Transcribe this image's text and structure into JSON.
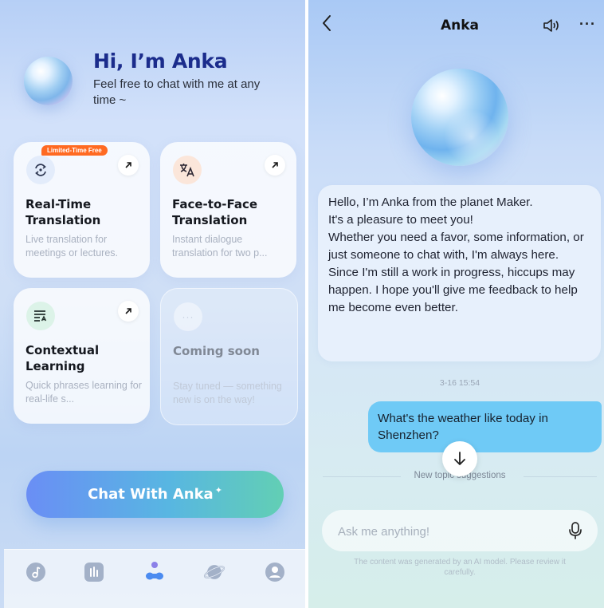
{
  "home": {
    "title": "Hi, I’m Anka",
    "subtitle": "Feel free to chat with me at any time ~",
    "cards": [
      {
        "badge": "Limited-Time Free",
        "title": "Real-Time Translation",
        "desc": "Live translation for meetings or lectures.",
        "icon": "translate-cycle-icon"
      },
      {
        "title": "Face-to-Face Translation",
        "desc": "Instant dialogue translation for two p...",
        "icon": "language-translate-icon"
      },
      {
        "title": "Contextual Learning",
        "desc": "Quick phrases learning for real-life s...",
        "icon": "document-list-icon"
      },
      {
        "title": "Coming soon",
        "desc": "Stay tuned — something new is on the way!",
        "icon": "more-dots-icon"
      }
    ],
    "cta_label": "Chat With Anka",
    "tabs": [
      "music-note-icon",
      "equalizer-icon",
      "ai-assistant-icon",
      "planet-icon",
      "profile-icon"
    ]
  },
  "chat": {
    "title": "Anka",
    "bot_message": "Hello, I’m Anka from the planet Maker.\nIt's a pleasure to meet you!\nWhether you need a favor, some information, or just someone to chat with, I'm always here.\nSince I'm still a work in progress, hiccups may happen. I hope you'll give me feedback to help me become even better.",
    "timestamp": "3-16 15:54",
    "user_message": "What's the weather like today in Shenzhen?",
    "topic_label": "New topic suggestions",
    "input_placeholder": "Ask me anything!",
    "disclaimer": "The content was generated by an AI model. Please review it carefully."
  },
  "colors": {
    "title_blue": "#1b2c8c",
    "badge_orange": "#ff6a22",
    "user_bubble": "#6fcaf6",
    "bot_bubble": "#e7f0fc"
  }
}
